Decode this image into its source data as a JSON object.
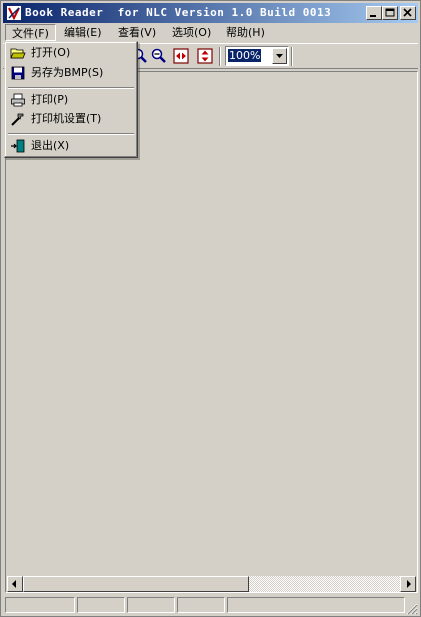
{
  "window": {
    "title": "Book Reader  for NLC Version 1.0 Build 0013"
  },
  "menubar": [
    {
      "label": "文件(F)"
    },
    {
      "label": "编辑(E)"
    },
    {
      "label": "查看(V)"
    },
    {
      "label": "选项(O)"
    },
    {
      "label": "帮助(H)"
    }
  ],
  "file_menu": [
    {
      "label": "打开(O)",
      "icon": "open-folder-icon"
    },
    {
      "label": "另存为BMP(S)",
      "icon": "floppy-disk-icon"
    },
    {
      "label": "打印(P)",
      "icon": "printer-icon"
    },
    {
      "label": "打印机设置(T)",
      "icon": "printer-setup-icon"
    },
    {
      "label": "退出(X)",
      "icon": "exit-door-icon"
    }
  ],
  "toolbar": {
    "zoom_value": "100%"
  },
  "colors": {
    "title_start": "#0a246a",
    "title_end": "#a6caf0",
    "face": "#d4d0c8"
  }
}
